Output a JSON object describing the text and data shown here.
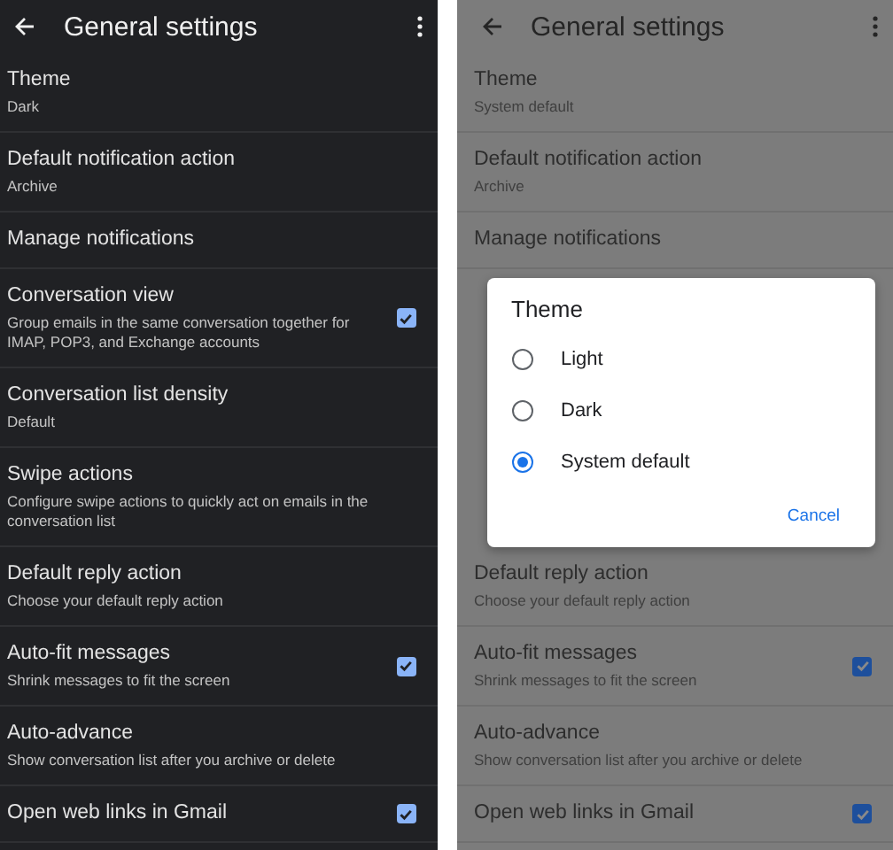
{
  "screens": [
    {
      "kind": "dark",
      "title": "General settings",
      "settings": [
        {
          "kind": "row",
          "title": "Theme",
          "subtitle": "Dark"
        },
        {
          "kind": "row",
          "title": "Default notification action",
          "subtitle": "Archive"
        },
        {
          "kind": "row",
          "title": "Manage notifications"
        },
        {
          "kind": "row",
          "title": "Conversation view",
          "subtitle": "Group emails in the same conversation together for IMAP, POP3, and Exchange accounts",
          "checked": true
        },
        {
          "kind": "row",
          "title": "Conversation list density",
          "subtitle": "Default"
        },
        {
          "kind": "row",
          "title": "Swipe actions",
          "subtitle": "Configure swipe actions to quickly act on emails in the conversation list"
        },
        {
          "kind": "row",
          "title": "Default reply action",
          "subtitle": "Choose your default reply action"
        },
        {
          "kind": "row",
          "title": "Auto-fit messages",
          "subtitle": "Shrink messages to fit the screen",
          "checked": true
        },
        {
          "kind": "row",
          "title": "Auto-advance",
          "subtitle": "Show conversation list after you archive or delete"
        },
        {
          "kind": "row",
          "title": "Open web links in Gmail",
          "checked": true
        }
      ]
    },
    {
      "kind": "dimmed",
      "title": "General settings",
      "settings": [
        {
          "kind": "row",
          "title": "Theme",
          "subtitle": "System default"
        },
        {
          "kind": "row",
          "title": "Default notification action",
          "subtitle": "Archive"
        },
        {
          "kind": "row",
          "title": "Manage notifications"
        },
        {
          "kind": "dialog",
          "title": "Theme",
          "options": [
            {
              "label": "Light",
              "selected": false
            },
            {
              "label": "Dark",
              "selected": false
            },
            {
              "label": "System default",
              "selected": true
            }
          ],
          "button": "Cancel"
        },
        {
          "kind": "row",
          "title": "Default reply action",
          "subtitle": "Choose your default reply action"
        },
        {
          "kind": "row",
          "title": "Auto-fit messages",
          "subtitle": "Shrink messages to fit the screen",
          "checked": true
        },
        {
          "kind": "row",
          "title": "Auto-advance",
          "subtitle": "Show conversation list after you archive or delete"
        },
        {
          "kind": "row",
          "title": "Open web links in Gmail",
          "checked": true
        }
      ]
    }
  ]
}
